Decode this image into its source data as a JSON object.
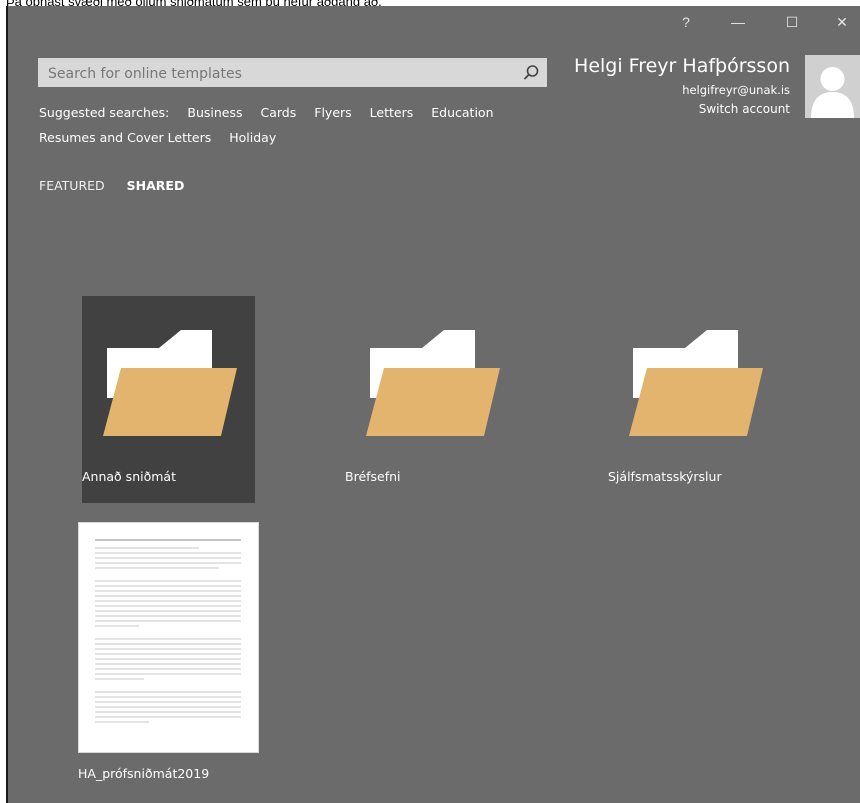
{
  "caption": "Þá opnast svæði með öllum sniðmátum sem þú hefur aðgang að.",
  "window": {
    "help_label": "?",
    "minimize_label": "—",
    "maximize_label": "☐",
    "close_label": "✕"
  },
  "search": {
    "placeholder": "Search for online templates",
    "icon": "search-icon"
  },
  "suggested": {
    "label": "Suggested searches:",
    "items": [
      "Business",
      "Cards",
      "Flyers",
      "Letters",
      "Education",
      "Resumes and Cover Letters",
      "Holiday"
    ]
  },
  "tabs": [
    {
      "label": "FEATURED",
      "active": false
    },
    {
      "label": "SHARED",
      "active": true
    }
  ],
  "user": {
    "name": "Helgi Freyr Hafþórsson",
    "email": "helgifreyr@unak.is",
    "switch_label": "Switch account"
  },
  "folders": [
    {
      "label": "Annað sniðmát",
      "selected": true
    },
    {
      "label": "Bréfsefni",
      "selected": false
    },
    {
      "label": "Sjálfsmatsskýrslur",
      "selected": false
    }
  ],
  "document": {
    "label": "HA_prófsniðmát2019"
  },
  "colors": {
    "background": "#6b6b6b",
    "selected_tile": "#414141",
    "folder_front": "#e3b46e",
    "folder_back": "#ffffff"
  }
}
